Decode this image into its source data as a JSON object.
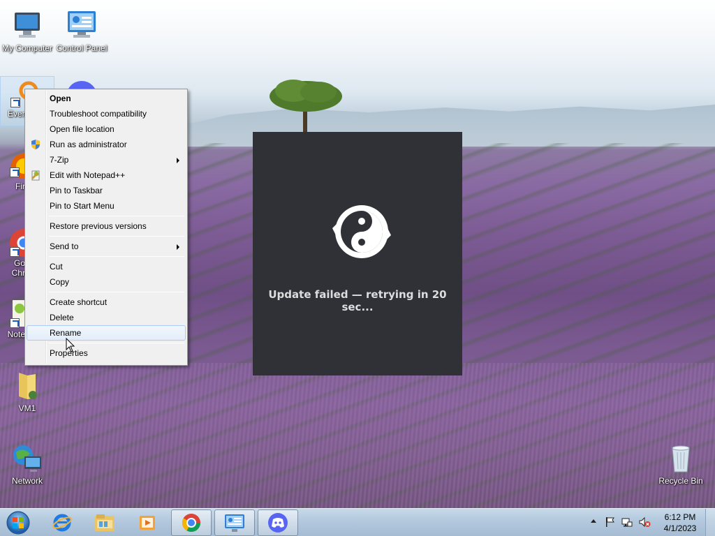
{
  "desktop": {
    "icons": {
      "my_computer": "My Computer",
      "control_panel": "Control Panel",
      "everything": "Every",
      "firefox": "Fir",
      "chrome_line1": "Go",
      "chrome_line2": "Chr",
      "notepad": "Note",
      "vm1": "VM1",
      "network": "Network",
      "recycle_bin": "Recycle Bin"
    }
  },
  "context_menu": {
    "items": [
      {
        "label": "Open"
      },
      {
        "label": "Troubleshoot compatibility"
      },
      {
        "label": "Open file location"
      },
      {
        "label": "Run as administrator",
        "icon": "uac-shield-icon"
      },
      {
        "label": "7-Zip",
        "submenu": true
      },
      {
        "label": "Edit with Notepad++",
        "icon": "notepad-plus-plus-icon"
      },
      {
        "label": "Pin to Taskbar"
      },
      {
        "label": "Pin to Start Menu"
      },
      {
        "label": "Restore previous versions"
      },
      {
        "label": "Send to",
        "submenu": true
      },
      {
        "label": "Cut"
      },
      {
        "label": "Copy"
      },
      {
        "label": "Create shortcut"
      },
      {
        "label": "Delete"
      },
      {
        "label": "Rename",
        "highlighted": true
      },
      {
        "label": "Properties"
      }
    ]
  },
  "updater": {
    "message": "Update failed — retrying in 20 sec..."
  },
  "taskbar": {
    "pinned": [
      "start-button",
      "internet-explorer-icon",
      "file-explorer-icon",
      "media-player-icon",
      "chrome-icon",
      "control-panel-icon",
      "discord-icon"
    ],
    "clock": {
      "time": "6:12 PM",
      "date": "4/1/2023"
    }
  },
  "colors": {
    "updater_bg": "#2f3136",
    "menu_highlight_border": "#aeccf0",
    "taskbar": "#b3c8dd"
  }
}
